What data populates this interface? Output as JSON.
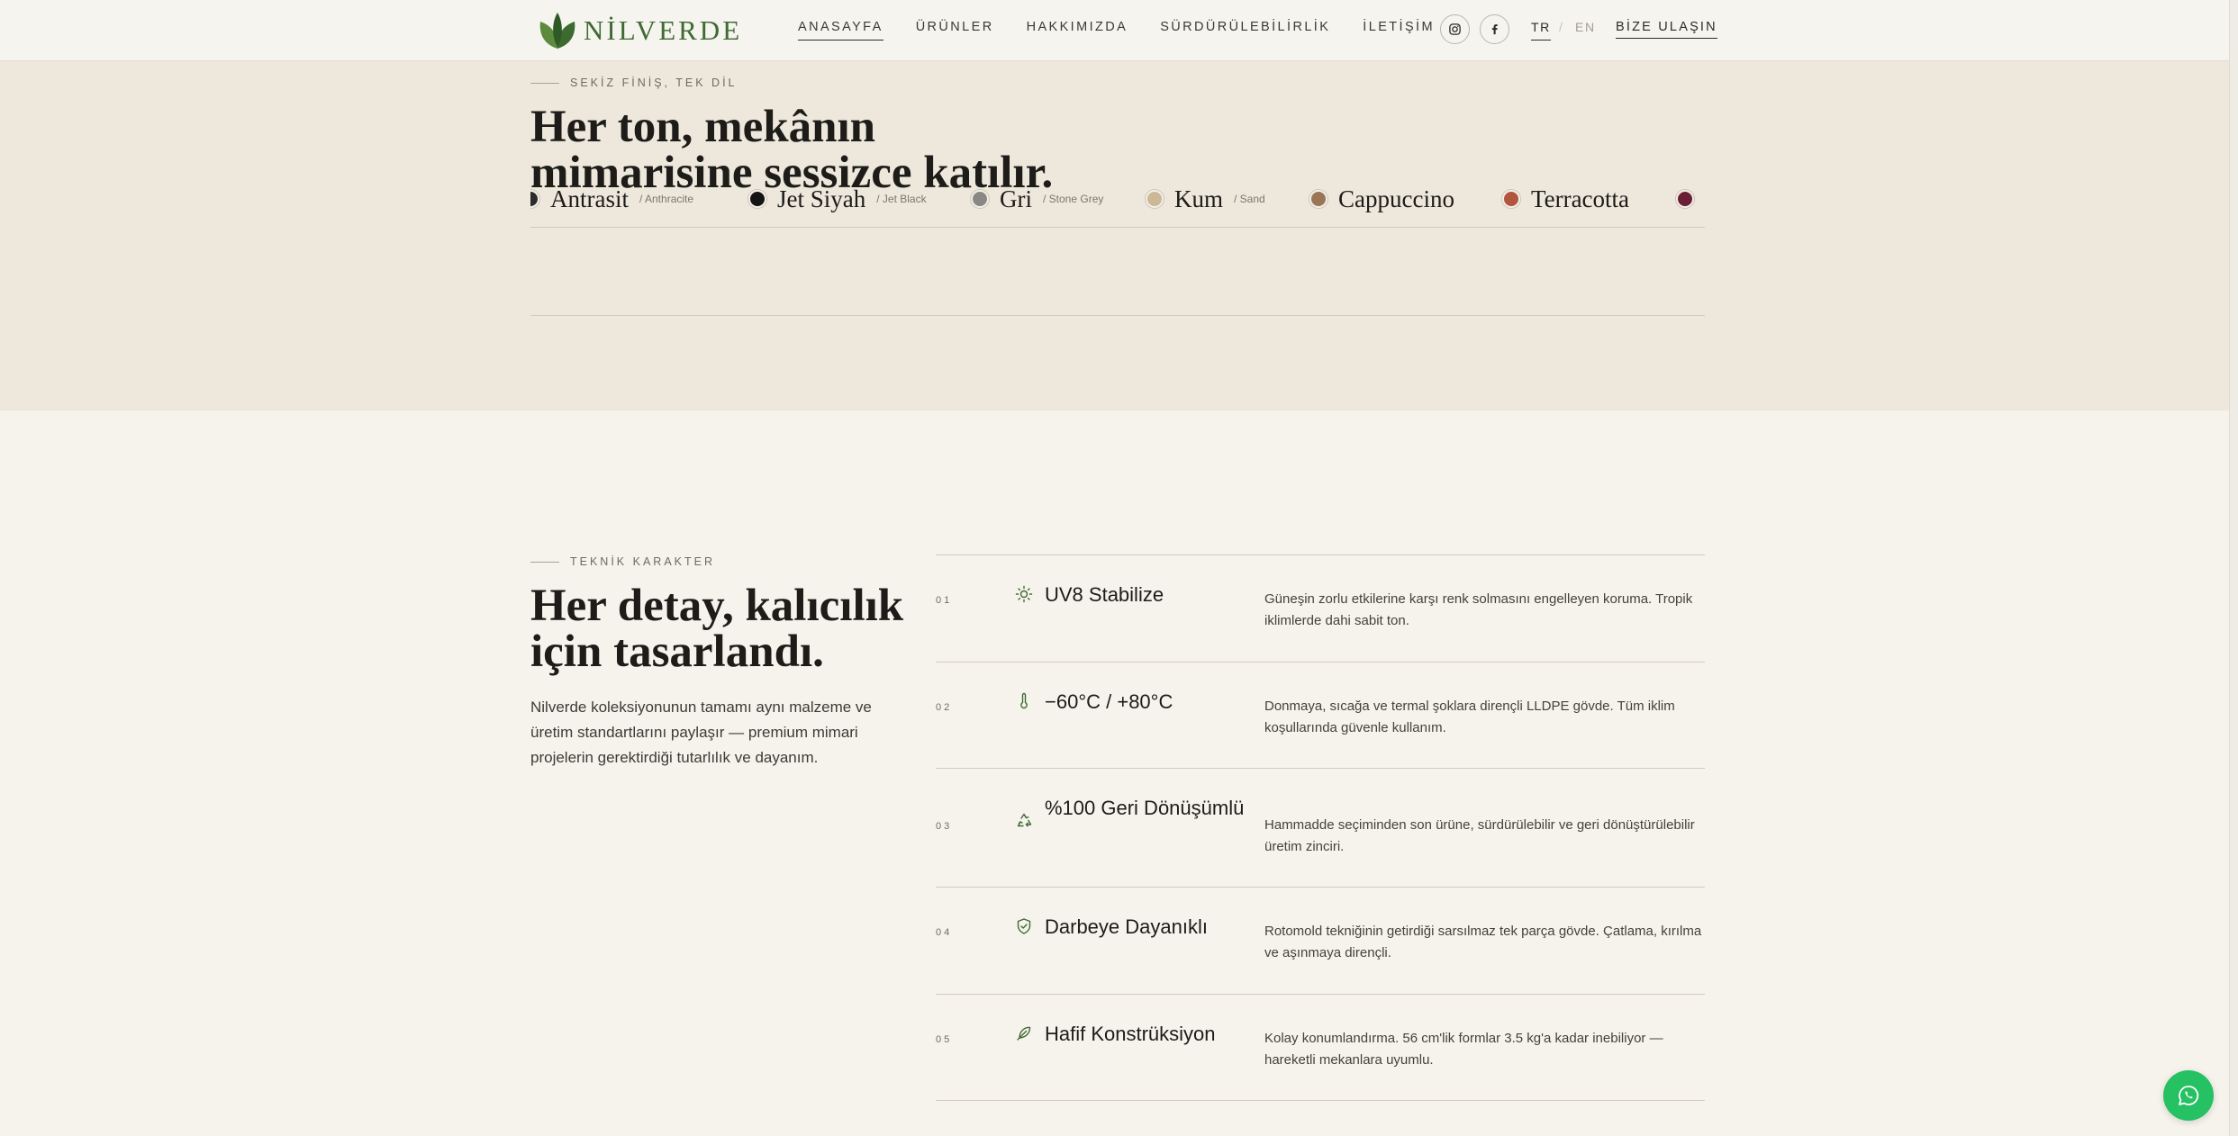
{
  "header": {
    "brand": "NİLVERDE",
    "nav": [
      {
        "label": "ANASAYFA",
        "active": true
      },
      {
        "label": "ÜRÜNLER",
        "active": false
      },
      {
        "label": "HAKKIMIZDA",
        "active": false
      },
      {
        "label": "SÜRDÜRÜLEBİLİRLİK",
        "active": false
      },
      {
        "label": "İLETİŞİM",
        "active": false
      }
    ],
    "social": [
      "instagram-icon",
      "facebook-icon"
    ],
    "lang_active": "TR",
    "lang_sep": "/",
    "lang_other": "EN",
    "contact": "BİZE ULAŞIN"
  },
  "finishes": {
    "eyebrow": "SEKİZ FİNİŞ, TEK DİL",
    "title_line1": "Her ton, mekânın",
    "title_line2": "mimarisine sessizce katılır.",
    "items": [
      {
        "name": "Antrasit",
        "en": "/ Anthracite",
        "color": "#2c2c2c"
      },
      {
        "name": "Jet Siyah",
        "en": "/ Jet Black",
        "color": "#141414"
      },
      {
        "name": "Gri",
        "en": "/ Stone Grey",
        "color": "#8a8885"
      },
      {
        "name": "Kum",
        "en": "/ Sand",
        "color": "#cbb896"
      },
      {
        "name": "Cappuccino",
        "en": "",
        "color": "#9a7656"
      },
      {
        "name": "Terracotta",
        "en": "",
        "color": "#b1553d"
      },
      {
        "name": "",
        "en": "",
        "color": "#6b1f35"
      }
    ]
  },
  "tech": {
    "eyebrow": "TEKNİK KARAKTER",
    "title_line1": "Her detay, kalıcılık",
    "title_line2": "için tasarlandı.",
    "lead": "Nilverde koleksiyonunun tamamı aynı malzeme ve üretim standartlarını paylaşır — premium mimari projelerin gerektirdiği tutarlılık ve dayanım.",
    "features": [
      {
        "num": "01",
        "icon": "sun-icon",
        "title": "UV8 Stabilize",
        "desc": "Güneşin zorlu etkilerine karşı renk solmasını engelleyen koruma. Tropik iklimlerde dahi sabit ton."
      },
      {
        "num": "02",
        "icon": "thermometer-icon",
        "title": "−60°C / +80°C",
        "desc": "Donmaya, sıcağa ve termal şoklara dirençli LLDPE gövde. Tüm iklim koşullarında güvenle kullanım."
      },
      {
        "num": "03",
        "icon": "recycle-icon",
        "title": "%100 Geri Dönüşümlü",
        "desc": "Hammadde seçiminden son ürüne, sürdürülebilir ve geri dönüştürülebilir üretim zinciri."
      },
      {
        "num": "04",
        "icon": "shield-icon",
        "title": "Darbeye Dayanıklı",
        "desc": "Rotomold tekniğinin getirdiği sarsılmaz tek parça gövde. Çatlama, kırılma ve aşınmaya dirençli."
      },
      {
        "num": "05",
        "icon": "feather-icon",
        "title": "Hafif Konstrüksiyon",
        "desc": "Kolay konumlandırma. 56 cm'lik formlar 3.5 kg'a kadar inebiliyor — hareketli mekanlara uyumlu."
      }
    ]
  },
  "whatsapp": "whatsapp-icon",
  "colors": {
    "accent_green": "#3f6a34",
    "whatsapp": "#25c163"
  }
}
